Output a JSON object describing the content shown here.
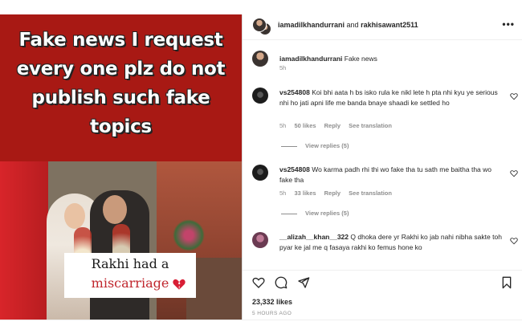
{
  "post": {
    "media": {
      "headline": "Fake news I request every one plz do not publish such fake topics",
      "caption_line1": "Rakhi had a",
      "caption_line2": "miscarriage"
    },
    "header": {
      "user1": "iamadilkhandurrani",
      "joiner": " and ",
      "user2": "rakhisawant2511",
      "more_icon": "more-horizontal-icon"
    },
    "comments": [
      {
        "user": "iamadilkhandurrani",
        "text": "Fake news",
        "time": "5h"
      },
      {
        "user": "vs254808",
        "text": "Koi bhi aata h bs isko rula ke nikl lete h pta nhi kyu ye serious nhi ho jati apni life me banda bnaye shaadi ke settled ho",
        "time": "5h",
        "likes": "50 likes",
        "reply": "Reply",
        "translation": "See translation",
        "view_replies": "View replies (5)"
      },
      {
        "user": "vs254808",
        "text": "Wo karma padh rhi thi wo fake tha tu sath me baitha tha wo fake tha",
        "time": "5h",
        "likes": "33 likes",
        "reply": "Reply",
        "translation": "See translation",
        "view_replies": "View replies (5)"
      },
      {
        "user": "__alizah__khan__322",
        "text": "Q dhoka dere yr Rakhi ko jab nahi nibha sakte toh pyar ke jal me q fasaya rakhi ko femus hone ko"
      }
    ],
    "actions": {
      "like_icon": "heart-outline-icon",
      "comment_icon": "comment-icon",
      "share_icon": "send-icon",
      "save_icon": "bookmark-icon"
    },
    "likes_count": "23,332 likes",
    "time_ago": "5 HOURS AGO"
  }
}
